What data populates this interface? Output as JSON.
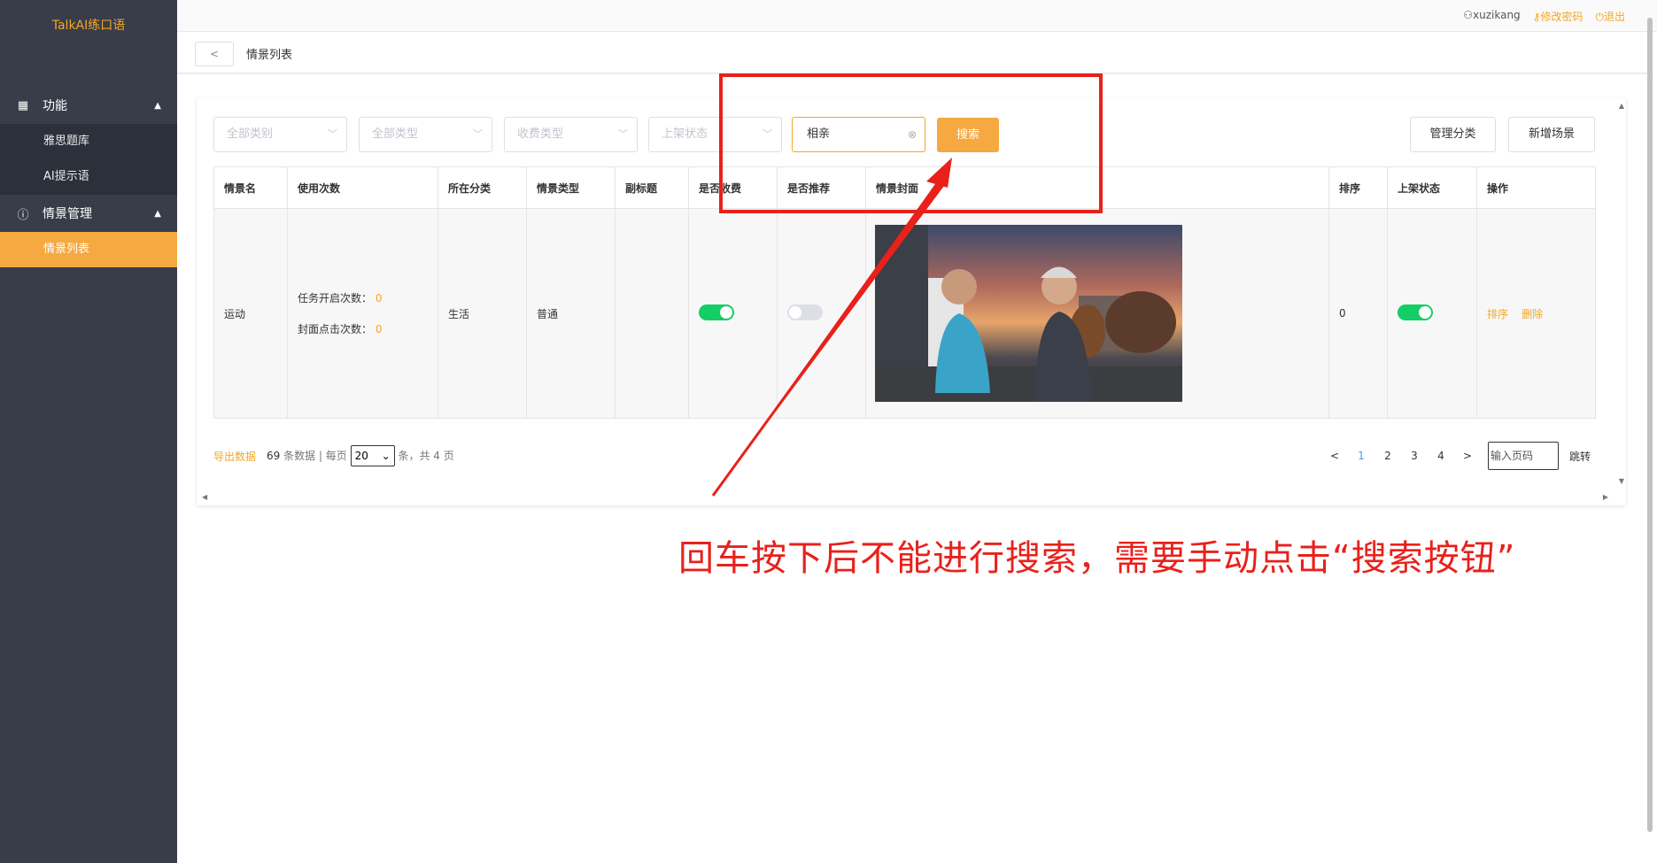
{
  "app": {
    "title": "TalkAI练口语"
  },
  "sidebar": {
    "groups": [
      {
        "label": "功能",
        "icon": "grid-icon",
        "items": [
          {
            "label": "雅思题库"
          },
          {
            "label": "AI提示语"
          }
        ]
      },
      {
        "label": "情景管理",
        "icon": "info-circle-icon",
        "items": [
          {
            "label": "情景列表",
            "active": true
          }
        ]
      }
    ]
  },
  "topbar": {
    "user": "xuzikang",
    "change_password": "修改密码",
    "logout": "退出"
  },
  "subbar": {
    "back": "<",
    "title": "情景列表"
  },
  "filters": {
    "category_placeholder": "全部类别",
    "type_placeholder": "全部类型",
    "fee_placeholder": "收费类型",
    "status_placeholder": "上架状态",
    "search_value": "相亲",
    "search_button": "搜索",
    "manage_category": "管理分类",
    "add_scene": "新增场景"
  },
  "table": {
    "columns": [
      "情景名",
      "使用次数",
      "所在分类",
      "情景类型",
      "副标题",
      "是否收费",
      "是否推荐",
      "情景封面",
      "排序",
      "上架状态",
      "操作"
    ],
    "rows": [
      {
        "name": "运动",
        "task_open_label": "任务开启次数：",
        "task_open_count": "0",
        "cover_click_label": "封面点击次数：",
        "cover_click_count": "0",
        "category": "生活",
        "type": "普通",
        "subtitle": "",
        "is_paid": true,
        "is_recommended": false,
        "sort": "0",
        "published": true,
        "action_sort": "排序",
        "action_delete": "删除"
      }
    ]
  },
  "footer": {
    "export": "导出数据",
    "total_count": "69",
    "total_suffix": "条数据 | 每页",
    "page_size": "20",
    "page_suffix": "条，共 4 页",
    "prev": "<",
    "pages": [
      "1",
      "2",
      "3",
      "4"
    ],
    "current_page": "1",
    "next": ">",
    "goto_placeholder": "输入页码",
    "goto_button": "跳转"
  },
  "annotation": {
    "text": "回车按下后不能进行搜索，需要手动点击“搜索按钮”",
    "color": "#e8211b"
  },
  "colors": {
    "accent": "#f5a623",
    "sidebar": "#383d4a",
    "toggle_on": "#13ce66",
    "annotation": "#e8211b"
  }
}
